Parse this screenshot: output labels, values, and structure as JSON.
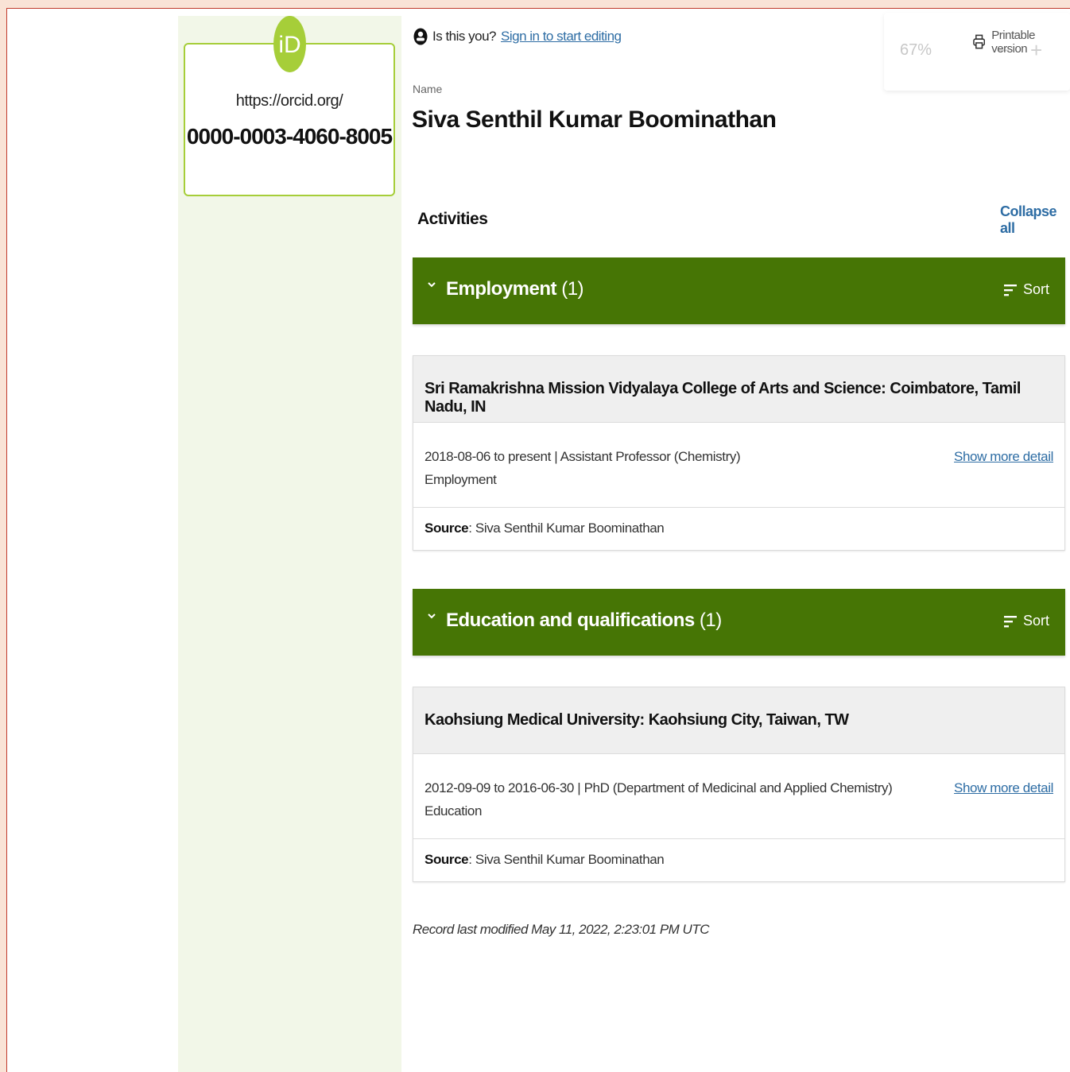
{
  "orcid": {
    "logo_text": "iD",
    "url": "https://orcid.org/",
    "number": "0000-0003-4060-8005"
  },
  "header": {
    "signin_prompt": "Is this you?",
    "signin_link": "Sign in to start editing",
    "printable_label": "Printable version",
    "zoom_level": "67%",
    "zoom_minus": "−",
    "zoom_plus": "+"
  },
  "profile": {
    "name_label": "Name",
    "name": "Siva Senthil Kumar Boominathan"
  },
  "activities": {
    "heading": "Activities",
    "collapse_label": "Collapse all",
    "sections": [
      {
        "title": "Employment",
        "count": "(1)",
        "sort_label": "Sort",
        "item": {
          "org": "Sri Ramakrishna Mission Vidyalaya College of Arts and Science: Coimbatore, Tamil Nadu, IN",
          "dates_role": "2018-08-06 to present | Assistant Professor (Chemistry)",
          "type": "Employment",
          "more_label": "Show more detail",
          "source_label": "Source",
          "source_value": ": Siva Senthil Kumar Boominathan"
        }
      },
      {
        "title": "Education and qualifications",
        "count": "(1)",
        "sort_label": "Sort",
        "item": {
          "org": "Kaohsiung Medical University: Kaohsiung City, Taiwan, TW",
          "dates_role": "2012-09-09 to 2016-06-30 | PhD (Department of Medicinal and Applied Chemistry)",
          "type": "Education",
          "more_label": "Show more detail",
          "source_label": "Source",
          "source_value": ": Siva Senthil Kumar Boominathan"
        }
      }
    ]
  },
  "footer": {
    "last_modified": "Record last modified May 11, 2022, 2:23:01 PM UTC"
  },
  "colors": {
    "section_bar": "#467505",
    "orcid_green": "#a6ce39",
    "sidebar_bg": "#f2f7e8",
    "link": "#2e6da4"
  },
  "icons": [
    "orcid-logo-icon",
    "user-icon",
    "printer-icon",
    "chevron-down-icon",
    "sort-icon"
  ]
}
